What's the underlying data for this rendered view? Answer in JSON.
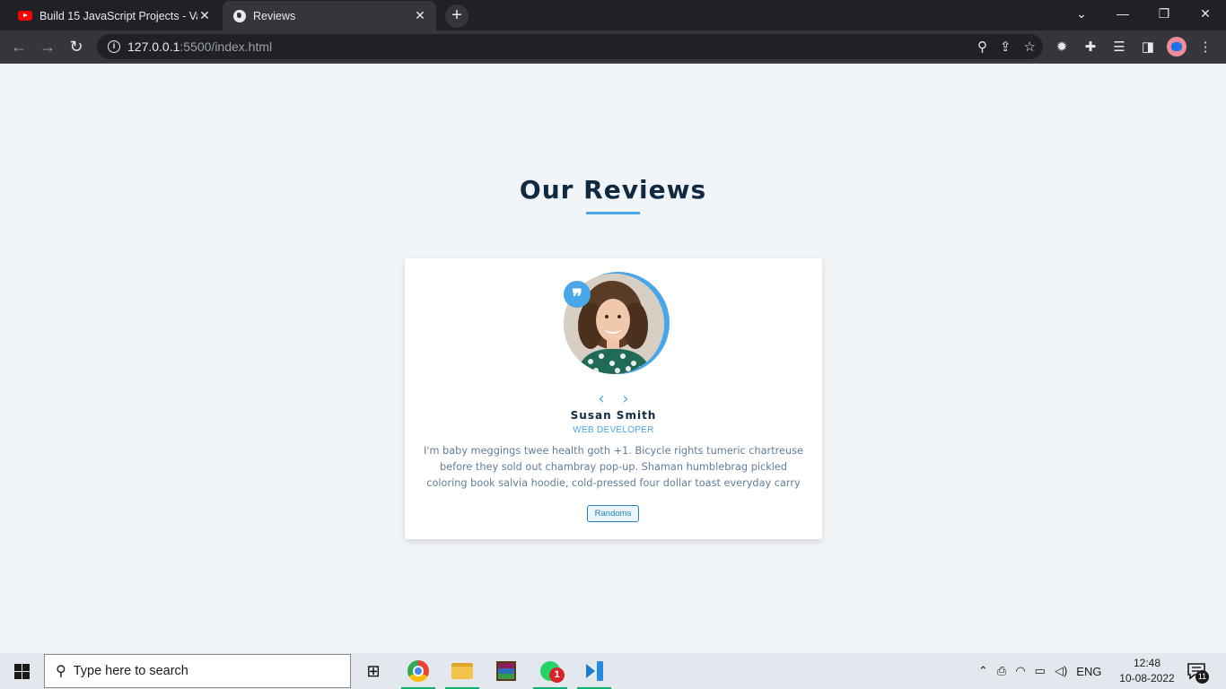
{
  "browser": {
    "tabs": [
      {
        "title": "Build 15 JavaScript Projects - Van",
        "icon": "youtube-icon",
        "active": false
      },
      {
        "title": "Reviews",
        "icon": "globe-icon",
        "active": true
      }
    ],
    "url_host": "127.0.0.1",
    "url_rest": ":5500/index.html"
  },
  "page": {
    "title": "Our Reviews",
    "accent_color": "#49a6e9",
    "review": {
      "author": "Susan Smith",
      "job": "WEB DEVELOPER",
      "text": "I'm baby meggings twee health goth +1. Bicycle rights tumeric chartreuse before they sold out chambray pop-up. Shaman humblebrag pickled coloring book salvia hoodie, cold-pressed four dollar toast everyday carry",
      "quote_glyph": "❞",
      "prev_glyph": "‹",
      "next_glyph": "›"
    },
    "random_button": "Randoms"
  },
  "taskbar": {
    "search_placeholder": "Type here to search",
    "whatsapp_badge": "1",
    "language": "ENG",
    "time": "12:48",
    "date": "10-08-2022",
    "notification_count": "11"
  }
}
